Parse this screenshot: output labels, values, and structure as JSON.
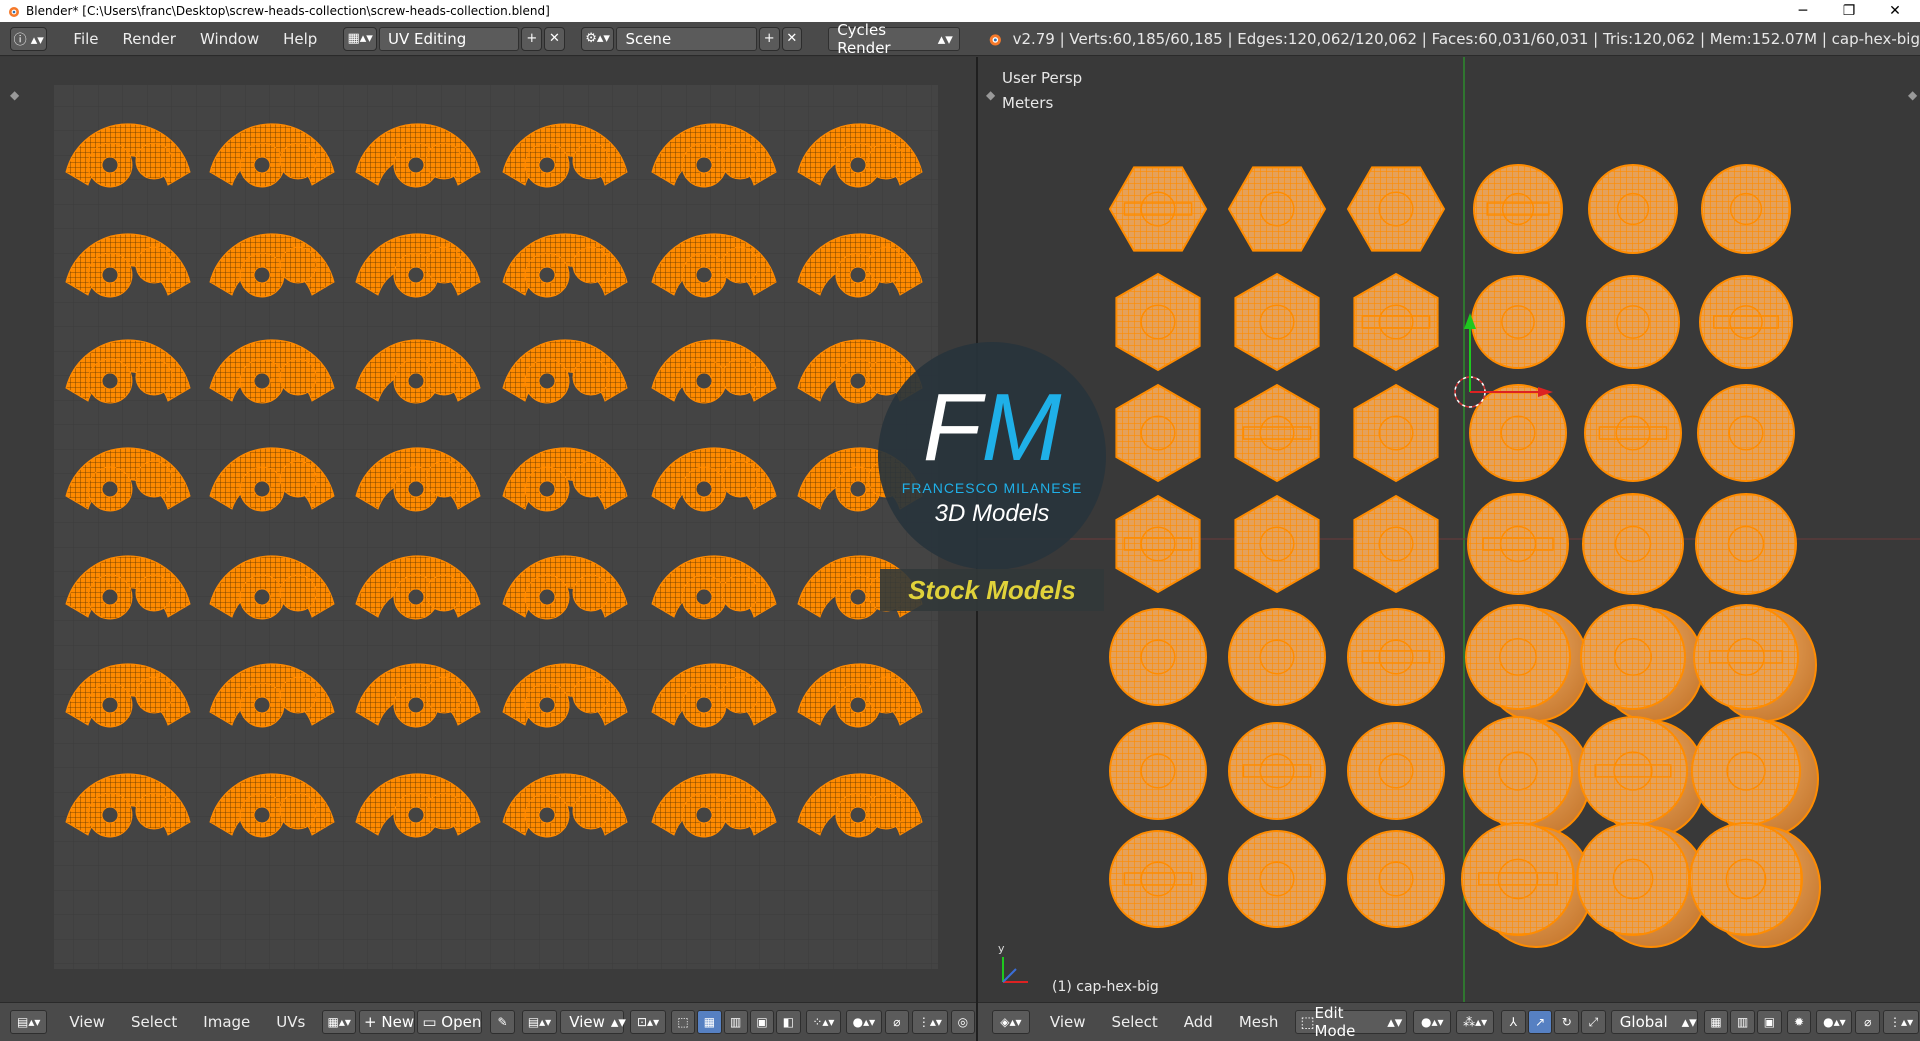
{
  "window": {
    "title": "Blender* [C:\\Users\\franc\\Desktop\\screw-heads-collection\\screw-heads-collection.blend]",
    "minimize": "─",
    "restore": "❐",
    "close": "✕"
  },
  "topbar": {
    "menus": [
      "File",
      "Render",
      "Window",
      "Help"
    ],
    "screen_layout": "UV Editing",
    "scene": "Scene",
    "render_engine": "Cycles Render",
    "stats": "v2.79 | Verts:60,185/60,185 | Edges:120,062/120,062 | Faces:60,031/60,031 | Tris:120,062 | Mem:152.07M | cap-hex-big"
  },
  "uv_editor": {
    "menus": [
      "View",
      "Select",
      "Image",
      "UVs"
    ],
    "new_label": "New",
    "open_label": "Open",
    "view_label": "View"
  },
  "viewport": {
    "view_name": "User Persp",
    "units": "Meters",
    "object_label": "(1) cap-hex-big",
    "menus": [
      "View",
      "Select",
      "Add",
      "Mesh"
    ],
    "mode": "Edit Mode",
    "orientation": "Global"
  },
  "watermark": {
    "fm": "FM",
    "name": "FRANCESCO MILANESE",
    "tagline": "3D Models",
    "badge": "Stock Models"
  },
  "colors": {
    "mesh_orange": "#ff8c00",
    "uv_orange": "#ff8a00",
    "fm_blue": "#1fb0e8",
    "stock_yellow": "#e0d23a",
    "active_blue": "#5680c2"
  }
}
